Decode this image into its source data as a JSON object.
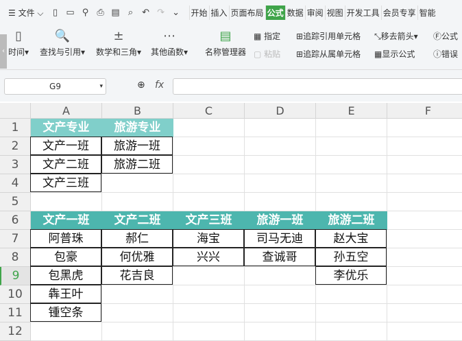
{
  "toolbar": {
    "file_menu": "文件",
    "tabs": [
      "开始",
      "插入",
      "页面布局",
      "公式",
      "数据",
      "审阅",
      "视图",
      "开发工具",
      "会员专享",
      "智能"
    ],
    "active_tab": "公式"
  },
  "ribbon": {
    "items": [
      "时间",
      "查找与引用",
      "数学和三角",
      "其他函数",
      "名称管理器",
      "指定",
      "粘贴",
      "追踪引用单元格",
      "追踪从属单元格",
      "移去箭头",
      "显示公式",
      "公式",
      "错误"
    ]
  },
  "formula_bar": {
    "name_box": "G9",
    "fx": "fx",
    "value": ""
  },
  "columns": [
    "A",
    "B",
    "C",
    "D",
    "E",
    "F"
  ],
  "rows": [
    "1",
    "2",
    "3",
    "4",
    "5",
    "6",
    "7",
    "8",
    "9",
    "10",
    "11",
    "12"
  ],
  "selected_row": "9",
  "sheet": {
    "r1": [
      "文产专业",
      "旅游专业"
    ],
    "r2": [
      "文产一班",
      "旅游一班"
    ],
    "r3": [
      "文产二班",
      "旅游二班"
    ],
    "r4": [
      "文产三班"
    ],
    "r6": [
      "文产一班",
      "文产二班",
      "文产三班",
      "旅游一班",
      "旅游二班"
    ],
    "r7": [
      "阿普珠",
      "郝仁",
      "海宝",
      "司马无迪",
      "赵大宝"
    ],
    "r8": [
      "包豪",
      "何优雅",
      "兴兴",
      "查诚哥",
      "孙五空"
    ],
    "r9": [
      "包黑虎",
      "花吉良",
      "",
      "",
      "李优乐"
    ],
    "r10": [
      "犇王叶"
    ],
    "r11": [
      "锺空条"
    ]
  },
  "colors": {
    "header1": "#80cfca",
    "header6": "#4db6ae",
    "accent": "#3fa44a"
  }
}
